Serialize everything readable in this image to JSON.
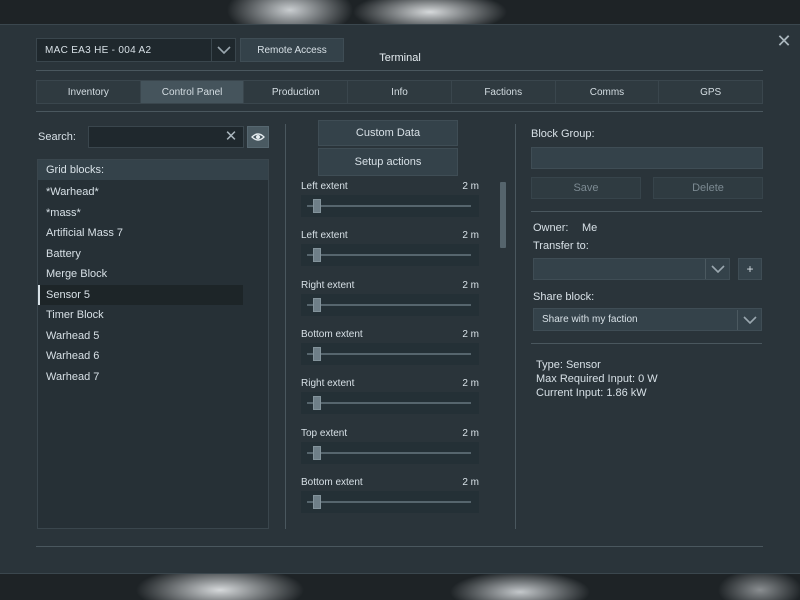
{
  "window": {
    "title": "Terminal",
    "grid_selector_value": "MAC EA3 HE - 004 A2",
    "remote_access_label": "Remote Access"
  },
  "tabs": [
    {
      "label": "Inventory",
      "active": false
    },
    {
      "label": "Control Panel",
      "active": true
    },
    {
      "label": "Production",
      "active": false
    },
    {
      "label": "Info",
      "active": false
    },
    {
      "label": "Factions",
      "active": false
    },
    {
      "label": "Comms",
      "active": false
    },
    {
      "label": "GPS",
      "active": false
    }
  ],
  "search": {
    "label": "Search:",
    "value": "",
    "placeholder": ""
  },
  "blocklist": {
    "header": "Grid blocks:",
    "items": [
      {
        "label": "*Warhead*",
        "selected": false
      },
      {
        "label": "*mass*",
        "selected": false
      },
      {
        "label": "Artificial Mass 7",
        "selected": false
      },
      {
        "label": "Battery",
        "selected": false
      },
      {
        "label": "Merge Block",
        "selected": false
      },
      {
        "label": "Sensor 5",
        "selected": true
      },
      {
        "label": "Timer Block",
        "selected": false
      },
      {
        "label": "Warhead 5",
        "selected": false
      },
      {
        "label": "Warhead 6",
        "selected": false
      },
      {
        "label": "Warhead 7",
        "selected": false
      }
    ]
  },
  "middle": {
    "custom_data_label": "Custom Data",
    "setup_actions_label": "Setup actions",
    "properties": [
      {
        "name": "Left extent",
        "value": "2 m"
      },
      {
        "name": "Left extent",
        "value": "2 m"
      },
      {
        "name": "Right extent",
        "value": "2 m"
      },
      {
        "name": "Bottom extent",
        "value": "2 m"
      },
      {
        "name": "Right extent",
        "value": "2 m"
      },
      {
        "name": "Top extent",
        "value": "2 m"
      },
      {
        "name": "Bottom extent",
        "value": "2 m"
      }
    ]
  },
  "right": {
    "block_group_label": "Block Group:",
    "block_group_value": "",
    "save_label": "Save",
    "delete_label": "Delete",
    "owner_label": "Owner:",
    "owner_value": "Me",
    "transfer_label": "Transfer to:",
    "transfer_value": "",
    "add_label": "+",
    "share_label": "Share block:",
    "share_value": "Share with my faction",
    "info_lines": [
      "Type: Sensor",
      "Max Required Input: 0 W",
      "Current Input: 1.86 kW"
    ]
  },
  "colors": {
    "panel": "#2a343a",
    "accent_active_tab": "#45545c",
    "text": "#d7e0e6"
  }
}
